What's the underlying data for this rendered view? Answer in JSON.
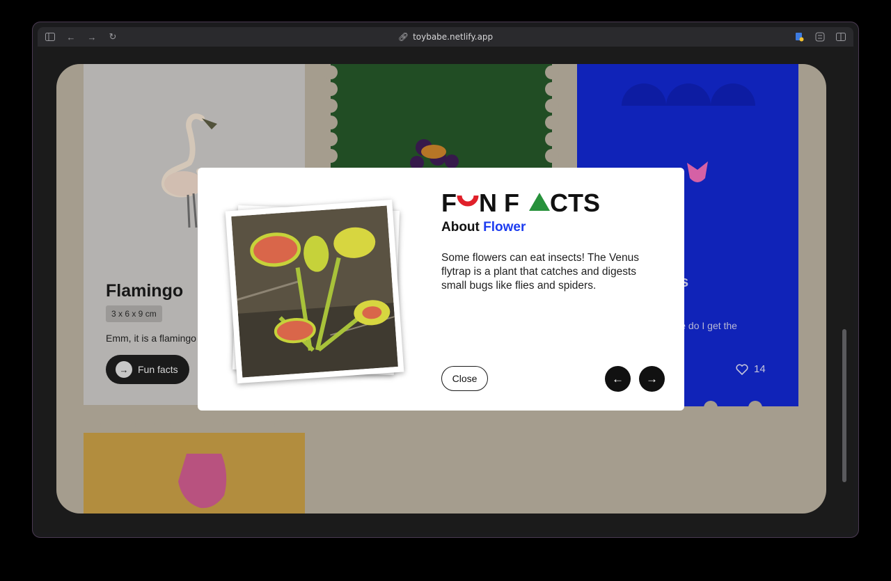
{
  "browser": {
    "url": "toybabe.netlify.app"
  },
  "cards": {
    "flamingo": {
      "title": "Flamingo",
      "dimensions": "3 x 6 x 9 cm",
      "description": "Emm, it is a flamingo",
      "fun_facts_label": "Fun facts"
    },
    "blue": {
      "title_fragment": "s",
      "description_fragment": "here do I get the",
      "likes": "14"
    }
  },
  "modal": {
    "title_parts": [
      "F",
      "N F",
      "CTS"
    ],
    "about_prefix": "About",
    "about_subject": "Flower",
    "fact": "Some flowers can eat insects! The Venus flytrap is a plant that catches and digests small bugs like flies and spiders.",
    "close_label": "Close",
    "prev_icon": "arrow-left-icon",
    "next_icon": "arrow-right-icon"
  },
  "colors": {
    "accent_blue": "#1c3cf0",
    "accent_red": "#e0202a",
    "accent_green": "#27913b",
    "page_bg": "#b3ab9b"
  }
}
